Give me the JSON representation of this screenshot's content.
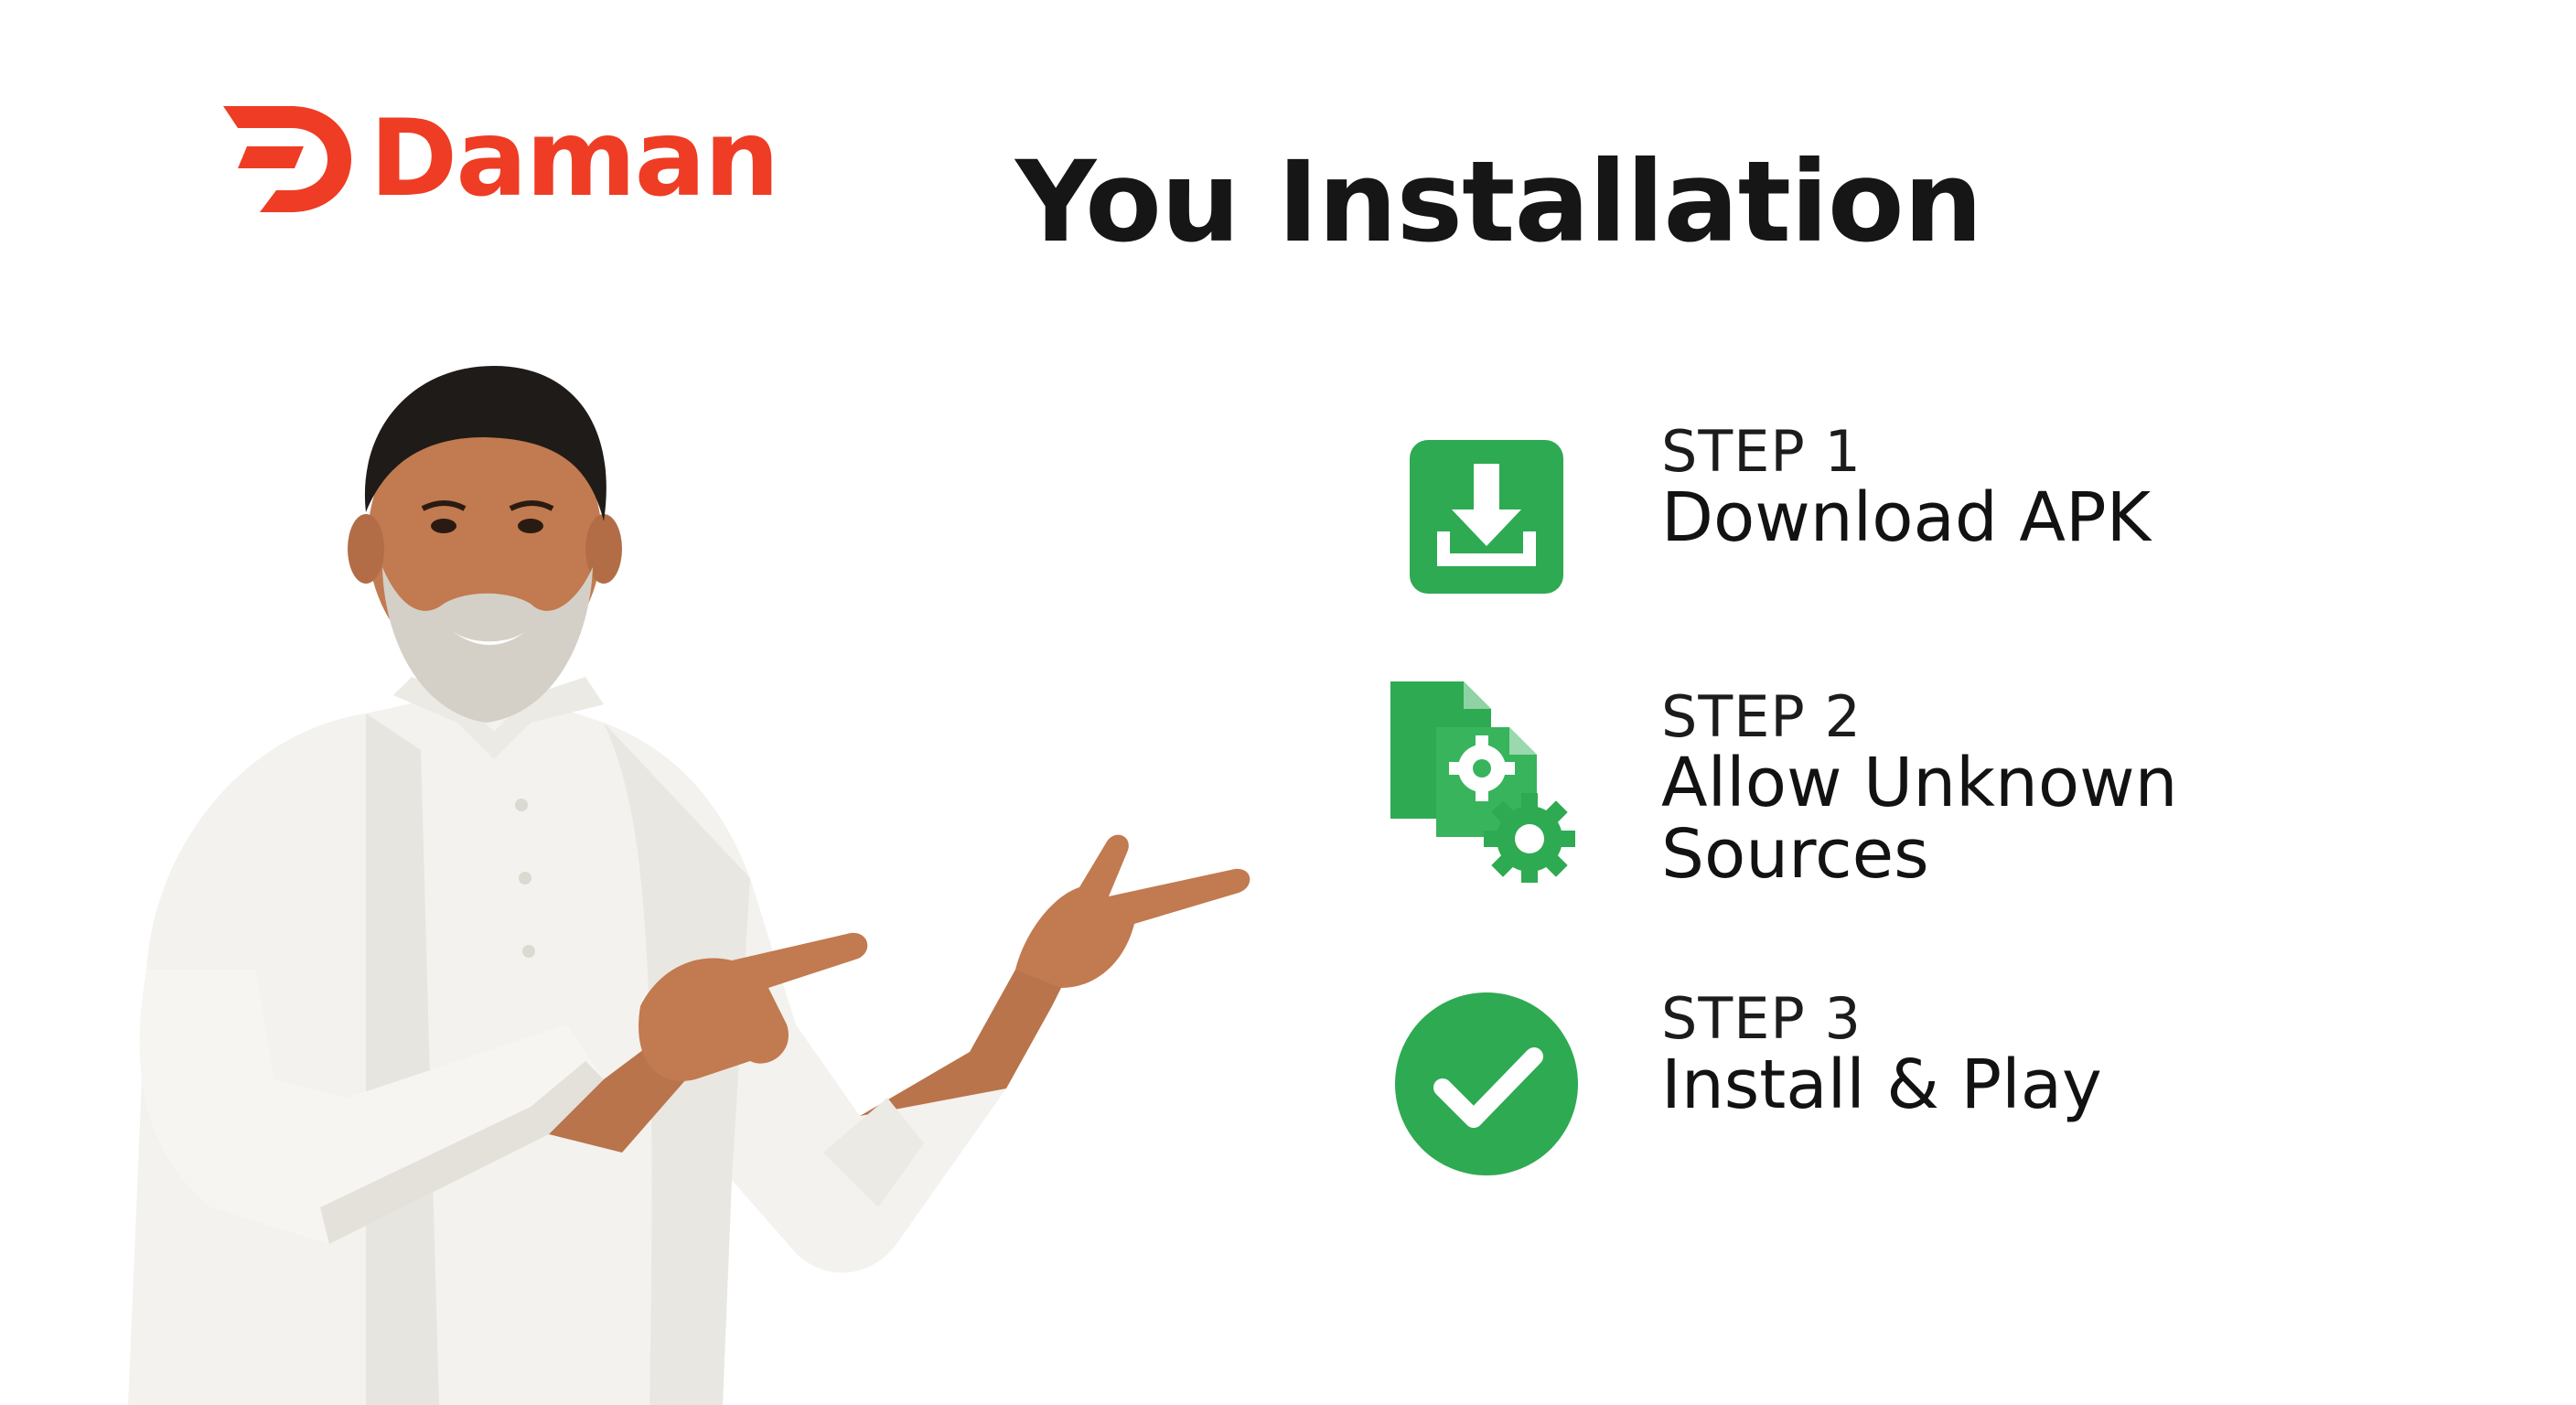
{
  "brand": {
    "name": "Daman",
    "color": "#ee3d24"
  },
  "title": "You Installation",
  "steps": [
    {
      "number": "STEP 1",
      "label": "Download APK",
      "icon": "download-icon",
      "color": "#2eaa52"
    },
    {
      "number": "STEP 2",
      "label": "Allow Unknown Sources",
      "icon": "settings-gear-file-icon",
      "color": "#2eaa52"
    },
    {
      "number": "STEP 3",
      "label": "Install & Play",
      "icon": "checkmark-icon",
      "color": "#2eaa52"
    }
  ]
}
